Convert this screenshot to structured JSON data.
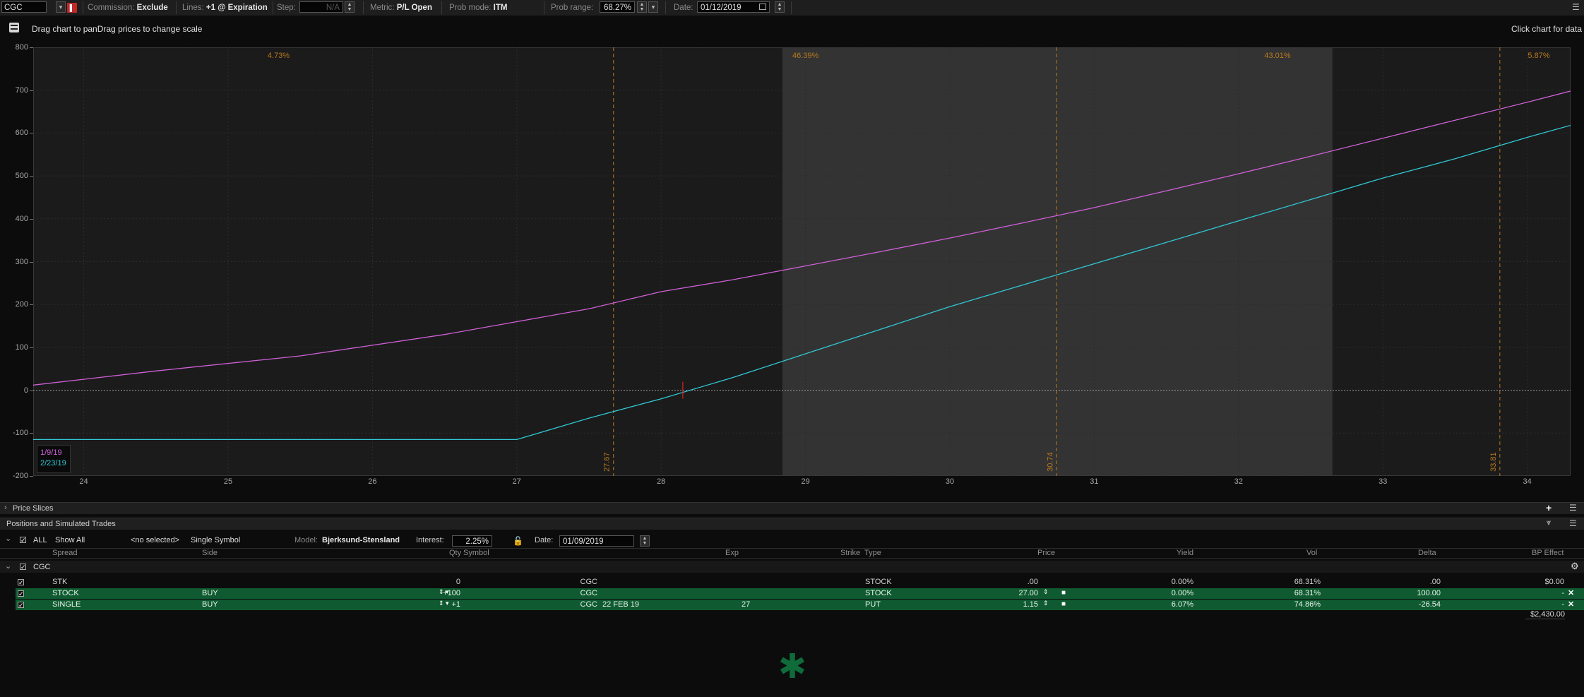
{
  "toolbar": {
    "symbol": "CGC",
    "commission_label": "Commission:",
    "commission_value": "Exclude",
    "lines_label": "Lines:",
    "lines_value": "+1 @ Expiration",
    "step_label": "Step:",
    "step_value": "N/A",
    "metric_label": "Metric:",
    "metric_value": "P/L Open",
    "prob_mode_label": "Prob mode:",
    "prob_mode_value": "ITM",
    "prob_range_label": "Prob range:",
    "prob_range_value": "68.27%",
    "date_label": "Date:",
    "date_value": "01/12/2019"
  },
  "chart_header": {
    "left_text": "Drag chart to panDrag prices to change scale",
    "right_text": "Click chart for data"
  },
  "chart_data": {
    "type": "line",
    "y_ticks": [
      "800",
      "700",
      "600",
      "500",
      "400",
      "300",
      "200",
      "100",
      "0",
      "-100",
      "-200"
    ],
    "x_ticks": [
      "24",
      "25",
      "26",
      "27",
      "28",
      "29",
      "30",
      "31",
      "32",
      "33",
      "34"
    ],
    "xlim": [
      23.65,
      34.3
    ],
    "ylim": [
      -200,
      800
    ],
    "grid": true,
    "region_probabilities": [
      "4.73%",
      "46.39%",
      "43.01%",
      "5.87%"
    ],
    "vertical_markers": [
      {
        "label": "27.67",
        "x": 27.67
      },
      {
        "label": "30.74",
        "x": 30.74
      },
      {
        "label": "33.81",
        "x": 33.81
      }
    ],
    "shaded_range": [
      28.84,
      32.65
    ],
    "current_price": 28.15,
    "series": [
      {
        "name": "1/9/19",
        "color": "#d060d8",
        "points": [
          [
            23.65,
            12
          ],
          [
            24.5,
            45
          ],
          [
            25.5,
            80
          ],
          [
            26.5,
            130
          ],
          [
            27,
            160
          ],
          [
            27.5,
            190
          ],
          [
            28,
            230
          ],
          [
            28.5,
            258
          ],
          [
            29,
            290
          ],
          [
            29.5,
            322
          ],
          [
            30,
            355
          ],
          [
            30.5,
            390
          ],
          [
            31,
            426
          ],
          [
            31.5,
            465
          ],
          [
            32,
            505
          ],
          [
            32.5,
            546
          ],
          [
            33,
            588
          ],
          [
            33.5,
            630
          ],
          [
            34,
            672
          ],
          [
            34.3,
            698
          ]
        ]
      },
      {
        "name": "2/23/19",
        "color": "#30c8d4",
        "points": [
          [
            23.65,
            -115
          ],
          [
            27,
            -115
          ],
          [
            27.5,
            -65
          ],
          [
            28,
            -20
          ],
          [
            28.5,
            30
          ],
          [
            29,
            85
          ],
          [
            29.5,
            140
          ],
          [
            30,
            195
          ],
          [
            30.5,
            245
          ],
          [
            31,
            295
          ],
          [
            31.5,
            345
          ],
          [
            32,
            395
          ],
          [
            32.5,
            445
          ],
          [
            33,
            495
          ],
          [
            33.5,
            540
          ],
          [
            34,
            590
          ],
          [
            34.3,
            618
          ]
        ]
      }
    ]
  },
  "price_slices": {
    "title": "Price Slices"
  },
  "positions": {
    "title": "Positions and Simulated Trades",
    "filter_all": "ALL",
    "show_all": "Show All",
    "no_selected": "<no selected>",
    "single_symbol": "Single Symbol",
    "model_label": "Model:",
    "model_value": "Bjerksund-Stensland",
    "interest_label": "Interest:",
    "interest_value": "2.25%",
    "date_label": "Date:",
    "date_value": "01/09/2019",
    "columns": {
      "spread": "Spread",
      "side": "Side",
      "qty": "Qty",
      "symbol": "Symbol",
      "exp": "Exp",
      "strike": "Strike",
      "type": "Type",
      "price": "Price",
      "yield": "Yield",
      "vol": "Vol",
      "delta": "Delta",
      "bp_effect": "BP Effect"
    },
    "group_name": "CGC",
    "rows": [
      {
        "spread": "STK",
        "side": "",
        "qty": "0",
        "symbol": "CGC",
        "exp": "",
        "strike": "",
        "type": "STOCK",
        "price": ".00",
        "yield": "0.00%",
        "vol": "68.31%",
        "delta": ".00",
        "bp_effect": "$0.00",
        "green": false
      },
      {
        "spread": "STOCK",
        "side": "BUY",
        "qty": "+100",
        "symbol": "CGC",
        "exp": "",
        "strike": "",
        "type": "STOCK",
        "price": "27.00",
        "yield": "0.00%",
        "vol": "68.31%",
        "delta": "100.00",
        "bp_effect": "-",
        "green": true
      },
      {
        "spread": "SINGLE",
        "side": "BUY",
        "qty": "+1",
        "symbol": "CGC",
        "exp": "22 FEB 19",
        "strike": "27",
        "type": "PUT",
        "price": "1.15",
        "yield": "6.07%",
        "vol": "74.86%",
        "delta": "-26.54",
        "bp_effect": "-",
        "green": true
      }
    ],
    "total_bp": "$2,430.00"
  }
}
